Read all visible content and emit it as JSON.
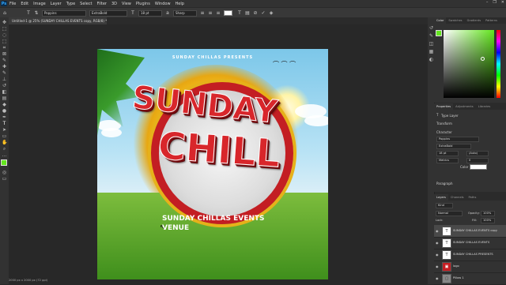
{
  "app": {
    "logo": "Ps"
  },
  "menu": [
    "File",
    "Edit",
    "Image",
    "Layer",
    "Type",
    "Select",
    "Filter",
    "3D",
    "View",
    "Plugins",
    "Window",
    "Help"
  ],
  "window_controls": {
    "minimize": "–",
    "restore": "❐",
    "close": "✕"
  },
  "options_bar": {
    "font_family": "Poppins",
    "font_style": "ExtraBold",
    "font_size": "18 pt",
    "antialias": "Sharp",
    "cancel": "⊘",
    "commit": "✓"
  },
  "document_tab": {
    "label": "Untitled-1 @ 25% (SUNDAY CHILLAS EVENTS copy, RGB/8) *"
  },
  "poster": {
    "presents": "SUNDAY CHILLAS PRESENTS",
    "birds": "⌒ ⌒ ⌒",
    "title_line1": "SUNDAY",
    "title_line2": "CHILL",
    "event_name": "SUNDAY CHILLAS EVENTS",
    "venue": "VENUE"
  },
  "color_panel": {
    "tabs": [
      "Color",
      "Swatches",
      "Gradients",
      "Patterns"
    ],
    "fg_color": "#63e61e"
  },
  "properties_panel": {
    "tabs": [
      "Properties",
      "Adjustments",
      "Libraries"
    ],
    "layer_type": "Type Layer",
    "transform": "Transform",
    "character": "Character",
    "font_family": "Poppins",
    "font_style": "ExtraBold",
    "size": "18 pt",
    "leading": "(Auto)",
    "tracking_label": "Metrics",
    "tracking_value": "0",
    "color_label": "Color",
    "paragraph": "Paragraph"
  },
  "layers_panel": {
    "tabs": [
      "Layers",
      "Channels",
      "Paths"
    ],
    "kind": "Kind",
    "blend_mode": "Normal",
    "opacity_label": "Opacity:",
    "opacity_value": "100%",
    "lock_label": "Lock:",
    "fill_label": "Fill:",
    "fill_value": "100%",
    "layers": [
      {
        "name": "SUNDAY CHILLAS EVENTS copy",
        "thumb": "T"
      },
      {
        "name": "SUNDAY CHILLAS EVENTS",
        "thumb": "T"
      },
      {
        "name": "SUNDAY CHILLAS PRESENTS",
        "thumb": "T"
      },
      {
        "name": "logo",
        "thumb": "▣"
      },
      {
        "name": "Pillow 1",
        "thumb": "▢"
      }
    ]
  },
  "status_bar": {
    "text": "2000 px x 2000 px (72 ppi)"
  }
}
